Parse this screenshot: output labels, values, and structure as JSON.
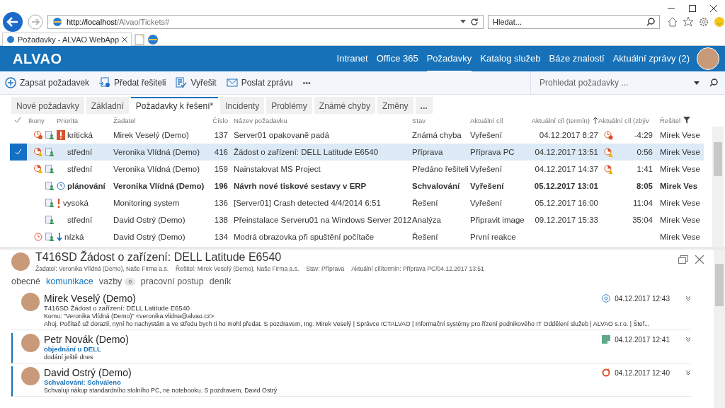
{
  "browser": {
    "url_host": "http://localhost",
    "url_path": "/Alvao/Tickets#",
    "search_placeholder": "Hledat...",
    "tab_title": "Požadavky - ALVAO WebApp"
  },
  "header": {
    "logo": "ALVAO",
    "nav": [
      {
        "label": "Intranet",
        "selected": false
      },
      {
        "label": "Office 365",
        "selected": false
      },
      {
        "label": "Požadavky",
        "selected": true
      },
      {
        "label": "Katalog služeb",
        "selected": false
      },
      {
        "label": "Báze znalostí",
        "selected": false
      },
      {
        "label": "Aktuální zprávy (2)",
        "selected": false
      }
    ]
  },
  "toolbar": {
    "actions": [
      {
        "label": "Zapsat požadavek",
        "kind": "add"
      },
      {
        "label": "Předat řešiteli",
        "kind": "forward"
      },
      {
        "label": "Vyřešit",
        "kind": "resolve"
      },
      {
        "label": "Poslat zprávu",
        "kind": "mail"
      }
    ],
    "more": "•••",
    "search_placeholder": "Prohledat požadavky ..."
  },
  "view_tabs": {
    "items": [
      {
        "label": "Nové požadavky",
        "selected": false
      },
      {
        "label": "Základní",
        "selected": false
      },
      {
        "label": "Požadavky k řešení*",
        "selected": true
      },
      {
        "label": "Incidenty",
        "selected": false
      },
      {
        "label": "Problémy",
        "selected": false
      },
      {
        "label": "Známé chyby",
        "selected": false
      },
      {
        "label": "Změny",
        "selected": false
      }
    ],
    "more": "..."
  },
  "table": {
    "columns": [
      "Ikony",
      "Priorita",
      "Žadatel",
      "Číslo",
      "Název požadavku",
      "Stav",
      "Aktuální cíl",
      "Aktuální cíl (termín)",
      "Aktuální cíl (zbýv",
      "Řešitel"
    ],
    "rows": [
      {
        "selected": false,
        "unread": false,
        "state_icon": {
          "kind": "overdue"
        },
        "priority_icon": {
          "kind": "critical"
        },
        "priority": "kritická",
        "requester": "Mirek Veselý (Demo)",
        "number": "137",
        "title": "Server01 opakovaně padá",
        "status": "Známá chyba",
        "goal": "Vyřešení",
        "deadline": "04.12.2017 8:27",
        "sla_icon": {
          "kind": "overdue"
        },
        "remaining": "-4:29",
        "solver": "Mirek Vese"
      },
      {
        "selected": true,
        "unread": false,
        "state_icon": {
          "kind": "warning"
        },
        "priority": "střední",
        "requester": "Veronika Vlídná (Demo)",
        "number": "416",
        "title": "Žádost o zařízení: DELL Latitude E6540",
        "status": "Příprava",
        "goal": "Příprava PC",
        "deadline": "04.12.2017 13:51",
        "sla_icon": {
          "kind": "warning"
        },
        "remaining": "0:56",
        "solver": "Mirek Vese"
      },
      {
        "selected": false,
        "unread": false,
        "state_icon": {
          "kind": "warning"
        },
        "priority": "střední",
        "requester": "Veronika Vlídná (Demo)",
        "number": "159",
        "title": "Nainstalovat MS Project",
        "status": "Předáno řešiteli",
        "goal": "Vyřešení",
        "deadline": "04.12.2017 14:37",
        "sla_icon": {
          "kind": "warning"
        },
        "remaining": "1:41",
        "solver": "Mirek Vese"
      },
      {
        "selected": false,
        "unread": true,
        "priority_icon": {
          "kind": "planned"
        },
        "priority": "plánování",
        "requester": "Veronika Vlídná (Demo)",
        "number": "196",
        "title": "Návrh nové tiskové sestavy v ERP",
        "status": "Schvalování",
        "goal": "Vyřešení",
        "deadline": "05.12.2017 13:01",
        "remaining": "8:05",
        "solver": "Mirek Ves"
      },
      {
        "selected": false,
        "unread": false,
        "priority_icon": {
          "kind": "high"
        },
        "priority": "vysoká",
        "requester": "Monitoring system",
        "number": "136",
        "title": "[Server01] Crash detected 4/4/2014 6:51",
        "status": "Řešení",
        "goal": "Vyřešení",
        "deadline": "05.12.2017 16:00",
        "remaining": "11:04",
        "solver": "Mirek Vese"
      },
      {
        "selected": false,
        "unread": false,
        "priority": "střední",
        "requester": "David Ostrý (Demo)",
        "number": "138",
        "title": "Přeinstalace Serveru01 na Windows Server 2012",
        "status": "Analýza",
        "goal": "Připravit image",
        "deadline": "09.12.2017 15:33",
        "remaining": "35:04",
        "solver": "Mirek Vese"
      },
      {
        "selected": false,
        "unread": false,
        "state_icon": {
          "kind": "clock"
        },
        "priority_icon": {
          "kind": "low"
        },
        "priority": "nízká",
        "requester": "David Ostrý (Demo)",
        "number": "134",
        "title": "Modrá obrazovka při spuštění počítače",
        "status": "Řešení",
        "goal": "První reakce",
        "solver": "Mirek Vese"
      }
    ]
  },
  "detail": {
    "title": "T416SD Žádost o zařízení: DELL Latitude E6540",
    "meta": [
      "Žadatel: Veronika Vlídná (Demo), Naše Firma a.s.",
      "Řešitel: Mirek Veselý (Demo), Naše Firma a.s.",
      "Stav: Příprava",
      "Aktuální cíl/termín: Příprava PC/04.12.2017 13:51"
    ],
    "tabs": [
      {
        "label": "obecné",
        "selected": false
      },
      {
        "label": "komunikace",
        "selected": true
      },
      {
        "label": "vazby",
        "selected": false,
        "badge": "0"
      },
      {
        "label": "pracovní postup",
        "selected": false
      },
      {
        "label": "deník",
        "selected": false
      }
    ],
    "messages": [
      {
        "kind": "email",
        "accent": false,
        "author": "Mirek Veselý (Demo)",
        "subject": "T416SD Žádost o zařízení: DELL Latitude E6540",
        "to": "Komu: \"Veronika Vlídná (Demo)\" <veronika.vlidna@alvao.cz>",
        "body": "Ahoj. Počítač už dorazil, nyní ho nachystám a ve středu bych ti ho mohl předat. S pozdravem, Ing. Mirek Veselý | Správce ICTALVAO | Informační systémy pro řízení podnikového IT Oddělení služeb | ALVAO s.r.o. | Štef...",
        "time": "04.12.2017 12:43"
      },
      {
        "kind": "note",
        "accent": true,
        "author": "Petr Novák (Demo)",
        "subject": "objednání u DELL",
        "body": "dodání ještě dnes",
        "time": "04.12.2017 12:41"
      },
      {
        "kind": "approval",
        "accent": true,
        "author": "David Ostrý (Demo)",
        "subject": "Schvalování: Schváleno",
        "body": "Schvaluji nákup standardního stolního PC, ne notebooku. S pozdravem, David Ostrý",
        "time": "04.12.2017 12:40"
      }
    ]
  }
}
